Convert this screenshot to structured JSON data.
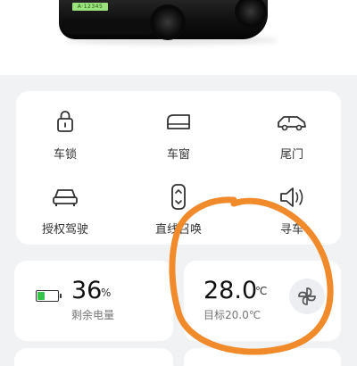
{
  "vehicle": {
    "plate_text": "A·12345"
  },
  "controls": [
    {
      "id": "lock",
      "label": "车锁",
      "icon": "lock-icon"
    },
    {
      "id": "window",
      "label": "车窗",
      "icon": "car-window-icon"
    },
    {
      "id": "tailgate",
      "label": "尾门",
      "icon": "tailgate-icon"
    },
    {
      "id": "auth-drive",
      "label": "授权驾驶",
      "icon": "car-front-icon"
    },
    {
      "id": "summon",
      "label": "直线召唤",
      "icon": "summon-icon"
    },
    {
      "id": "find-car",
      "label": "寻车",
      "icon": "horn-icon"
    }
  ],
  "battery": {
    "value": "36",
    "unit": "%",
    "label": "剩余电量",
    "level_fraction": 0.36,
    "fill_color": "#37c24a"
  },
  "climate": {
    "temperature": "28.0",
    "unit": "℃",
    "target_label": "目标20.0℃",
    "icon": "fan-icon"
  },
  "annotation": {
    "color": "#f08a2a"
  }
}
